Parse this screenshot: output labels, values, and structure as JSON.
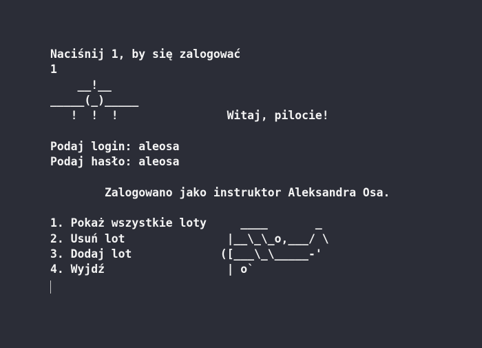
{
  "terminal": {
    "lines": [
      "Naciśnij 1, by się zalogować",
      "1",
      "    __!__",
      "_____(_)_____",
      "   !  !  !                Witaj, pilocie!",
      "",
      "Podaj login: aleosa",
      "Podaj hasło: aleosa",
      "",
      "        Zalogowano jako instruktor Aleksandra Osa.",
      "",
      "1. Pokaż wszystkie loty     ____       _",
      "2. Usuń lot               |__\\_\\_o,___/ \\",
      "3. Dodaj lot             ([___\\_\\_____-'",
      "4. Wyjdź                  | o`"
    ]
  }
}
